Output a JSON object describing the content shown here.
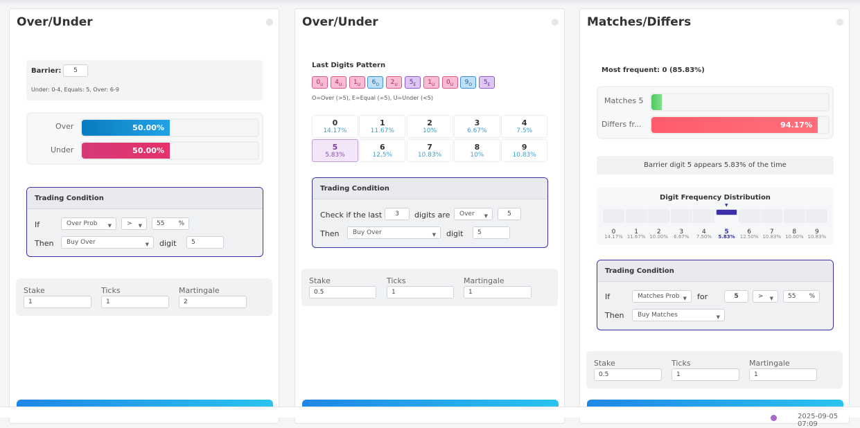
{
  "card1": {
    "title": "Over/Under",
    "barrier_label": "Barrier:",
    "barrier_value": "5",
    "barrier_note": "Under: 0-4, Equals: 5, Over: 6-9",
    "over_label": "Over",
    "over_pct": "50.00%",
    "over_fraction": 0.5,
    "under_label": "Under",
    "under_pct": "50.00%",
    "under_fraction": 0.5,
    "cond_title": "Trading Condition",
    "if_label": "If",
    "if_select": "Over Prob",
    "op_select": ">",
    "threshold": "55",
    "pct_sign": "%",
    "then_label": "Then",
    "then_select": "Buy Over",
    "digit_label": "digit",
    "digit_value": "5",
    "stake_label": "Stake",
    "stake": "1",
    "ticks_label": "Ticks",
    "ticks": "1",
    "mart_label": "Martingale",
    "martingale": "2"
  },
  "card2": {
    "title": "Over/Under",
    "pattern_title": "Last Digits Pattern",
    "pattern": [
      {
        "d": "0",
        "t": "U"
      },
      {
        "d": "4",
        "t": "U"
      },
      {
        "d": "1",
        "t": "U"
      },
      {
        "d": "6",
        "t": "O"
      },
      {
        "d": "2",
        "t": "U"
      },
      {
        "d": "5",
        "t": "E"
      },
      {
        "d": "1",
        "t": "U"
      },
      {
        "d": "0",
        "t": "U"
      },
      {
        "d": "9",
        "t": "O"
      },
      {
        "d": "5",
        "t": "E"
      }
    ],
    "pattern_legend": "O=Over (>5), E=Equal (=5), U=Under (<5)",
    "digits": [
      {
        "d": "0",
        "p": "14.17%"
      },
      {
        "d": "1",
        "p": "11.67%"
      },
      {
        "d": "2",
        "p": "10%"
      },
      {
        "d": "3",
        "p": "6.67%"
      },
      {
        "d": "4",
        "p": "7.5%"
      },
      {
        "d": "5",
        "p": "5.83%"
      },
      {
        "d": "6",
        "p": "12.5%"
      },
      {
        "d": "7",
        "p": "10.83%"
      },
      {
        "d": "8",
        "p": "10%"
      },
      {
        "d": "9",
        "p": "10.83%"
      }
    ],
    "cond_title": "Trading Condition",
    "check_label": "Check if the last",
    "last_n": "3",
    "digits_are_label": "digits are",
    "dir_select": "Over",
    "dir_value": "5",
    "then_label": "Then",
    "then_select": "Buy Over",
    "digit_label": "digit",
    "digit_value": "5",
    "stake_label": "Stake",
    "stake": "0.5",
    "ticks_label": "Ticks",
    "ticks": "1",
    "mart_label": "Martingale",
    "martingale": "1"
  },
  "card3": {
    "title": "Matches/Differs",
    "most_frequent": "Most frequent: 0 (85.83%)",
    "matches_label": "Matches 5",
    "matches_fraction": 0.0583,
    "differs_label": "Differs fr...",
    "differs_pct": "94.17%",
    "differs_fraction": 0.9417,
    "barrier_note": "Barrier digit 5 appears 5.83% of the time",
    "dist_title": "Digit Frequency Distribution",
    "dist": [
      {
        "d": "0",
        "p": "14.17%"
      },
      {
        "d": "1",
        "p": "11.67%"
      },
      {
        "d": "2",
        "p": "10.00%"
      },
      {
        "d": "3",
        "p": "6.67%"
      },
      {
        "d": "4",
        "p": "7.50%"
      },
      {
        "d": "5",
        "p": "5.83%"
      },
      {
        "d": "6",
        "p": "12.50%"
      },
      {
        "d": "7",
        "p": "10.83%"
      },
      {
        "d": "8",
        "p": "10.00%"
      },
      {
        "d": "9",
        "p": "10.83%"
      }
    ],
    "selected_digit": "5",
    "cond_title": "Trading Condition",
    "if_label": "If",
    "if_select": "Matches Prob",
    "for_label": "for",
    "for_value": "5",
    "op_select": ">",
    "threshold": "55",
    "pct_sign": "%",
    "then_label": "Then",
    "then_select": "Buy Matches",
    "stake_label": "Stake",
    "stake": "0.5",
    "ticks_label": "Ticks",
    "ticks": "1",
    "mart_label": "Martingale",
    "martingale": "1"
  },
  "footer": {
    "timestamp": "2025-09-05 07:09"
  },
  "colors": {
    "accent": "#3a2fa8",
    "over": "#1a8fd0",
    "under": "#e0386a",
    "matches": "#5fd06f",
    "differs": "#ff5a6a",
    "button": "#1e87e6"
  }
}
